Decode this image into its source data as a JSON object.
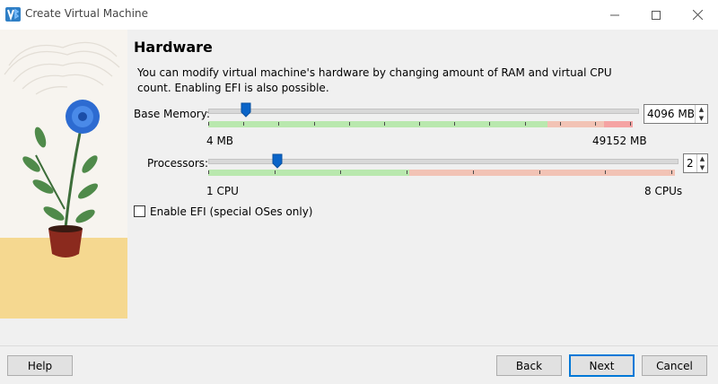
{
  "window": {
    "title": "Create Virtual Machine"
  },
  "page": {
    "heading": "Hardware",
    "description": "You can modify virtual machine's hardware by changing amount of RAM and virtual CPU count. Enabling EFI is also possible."
  },
  "memory": {
    "label": "Base Memory:",
    "value": 4096,
    "unit": "MB",
    "display": "4096 MB",
    "min_label": "4 MB",
    "max_label": "49152 MB",
    "min": 4,
    "max": 49152
  },
  "cpu": {
    "label": "Processors:",
    "value": 2,
    "display": "2",
    "min_label": "1 CPU",
    "max_label": "8 CPUs",
    "min": 1,
    "max": 8
  },
  "efi": {
    "label": "Enable EFI (special OSes only)",
    "checked": false
  },
  "buttons": {
    "help": "Help",
    "back": "Back",
    "next": "Next",
    "cancel": "Cancel"
  },
  "colors": {
    "safe_zone": "#b9e8ae",
    "warn_zone": "#f2c3b5",
    "danger_zone": "#f5a3a3",
    "handle": "#0a64c8",
    "default_button_border": "#0078d7"
  },
  "icons": {
    "app": "virtualbox-logo-icon",
    "minimize": "minimize-icon",
    "maximize": "maximize-icon",
    "close": "close-icon",
    "spin_up": "spin-up-icon",
    "spin_down": "spin-down-icon"
  }
}
